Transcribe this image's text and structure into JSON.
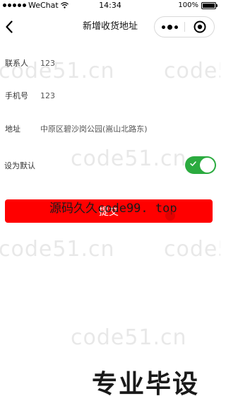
{
  "status_bar": {
    "carrier": "WeChat",
    "time": "14:34",
    "battery": "100%"
  },
  "nav": {
    "title": "新增收货地址"
  },
  "form": {
    "contact": {
      "label": "联系人",
      "value": "123"
    },
    "phone": {
      "label": "手机号",
      "value": "123"
    },
    "address": {
      "label": "地址",
      "value": "中原区碧沙岗公园(嵩山北路东)"
    },
    "default": {
      "label": "设为默认",
      "enabled": true
    }
  },
  "submit": {
    "label": "提交"
  },
  "watermarks": {
    "site": "code51.cn",
    "overlay_cn": "源码久久",
    "overlay_domain": "code99. top",
    "banner": "专业毕设"
  },
  "colors": {
    "accent": "#ff0000",
    "toggle_on": "#2bab3f"
  },
  "icons": {
    "back": "chevron-left-icon",
    "more": "more-dots-icon",
    "close": "target-circle-icon",
    "wifi": "wifi-icon",
    "battery": "battery-icon",
    "check": "check-icon"
  }
}
